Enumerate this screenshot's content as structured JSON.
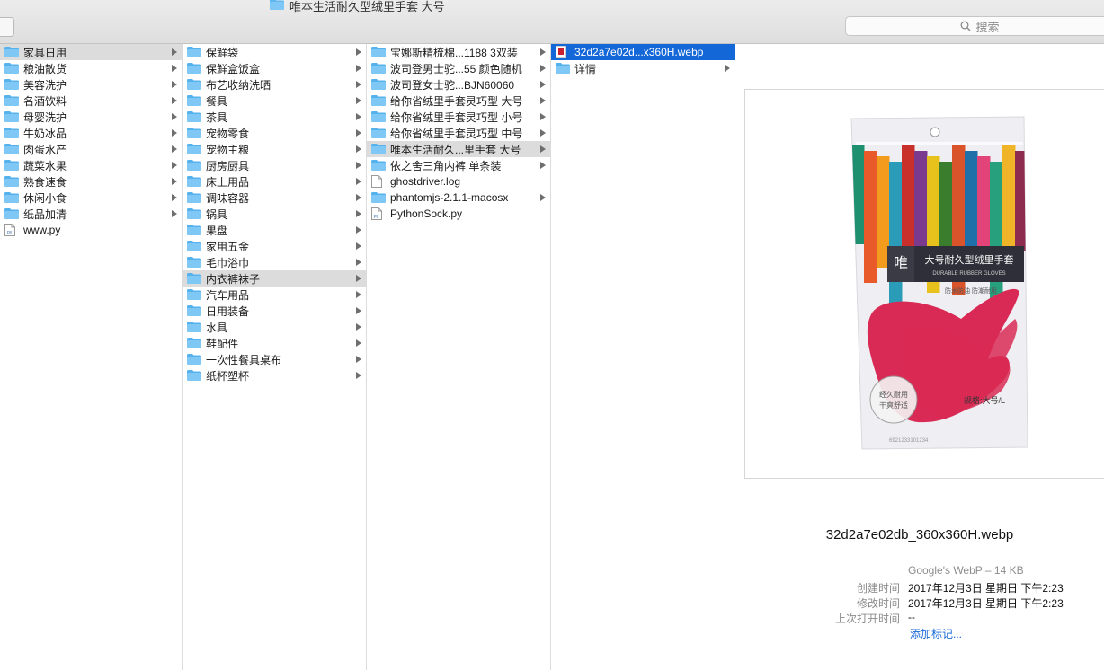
{
  "window": {
    "title": "唯本生活耐久型绒里手套 大号"
  },
  "search": {
    "placeholder": "搜索"
  },
  "columns": [
    {
      "items": [
        {
          "label": "家具日用",
          "type": "folder",
          "arrow": true,
          "state": "sel"
        },
        {
          "label": "粮油散货",
          "type": "folder",
          "arrow": true
        },
        {
          "label": "美容洗护",
          "type": "folder",
          "arrow": true
        },
        {
          "label": "名酒饮料",
          "type": "folder",
          "arrow": true
        },
        {
          "label": "母婴洗护",
          "type": "folder",
          "arrow": true
        },
        {
          "label": "牛奶冰品",
          "type": "folder",
          "arrow": true
        },
        {
          "label": "肉蛋水产",
          "type": "folder",
          "arrow": true
        },
        {
          "label": "蔬菜水果",
          "type": "folder",
          "arrow": true
        },
        {
          "label": "熟食速食",
          "type": "folder",
          "arrow": true
        },
        {
          "label": "休闲小食",
          "type": "folder",
          "arrow": true
        },
        {
          "label": "纸品加清",
          "type": "folder",
          "arrow": true
        },
        {
          "label": "www.py",
          "type": "file-py",
          "arrow": false
        }
      ]
    },
    {
      "items": [
        {
          "label": "保鲜袋",
          "type": "folder",
          "arrow": true
        },
        {
          "label": "保鲜盒饭盒",
          "type": "folder",
          "arrow": true
        },
        {
          "label": "布艺收纳洗晒",
          "type": "folder",
          "arrow": true
        },
        {
          "label": "餐具",
          "type": "folder",
          "arrow": true
        },
        {
          "label": "茶具",
          "type": "folder",
          "arrow": true
        },
        {
          "label": "宠物零食",
          "type": "folder",
          "arrow": true
        },
        {
          "label": "宠物主粮",
          "type": "folder",
          "arrow": true
        },
        {
          "label": "厨房厨具",
          "type": "folder",
          "arrow": true
        },
        {
          "label": "床上用品",
          "type": "folder",
          "arrow": true
        },
        {
          "label": "调味容器",
          "type": "folder",
          "arrow": true
        },
        {
          "label": "锅具",
          "type": "folder",
          "arrow": true
        },
        {
          "label": "果盘",
          "type": "folder",
          "arrow": true
        },
        {
          "label": "家用五金",
          "type": "folder",
          "arrow": true
        },
        {
          "label": "毛巾浴巾",
          "type": "folder",
          "arrow": true
        },
        {
          "label": "内衣裤袜子",
          "type": "folder",
          "arrow": true,
          "state": "sel"
        },
        {
          "label": "汽车用品",
          "type": "folder",
          "arrow": true
        },
        {
          "label": "日用装备",
          "type": "folder",
          "arrow": true
        },
        {
          "label": "水具",
          "type": "folder",
          "arrow": true
        },
        {
          "label": "鞋配件",
          "type": "folder",
          "arrow": true
        },
        {
          "label": "一次性餐具桌布",
          "type": "folder",
          "arrow": true
        },
        {
          "label": "纸杯塑杯",
          "type": "folder",
          "arrow": true
        }
      ]
    },
    {
      "items": [
        {
          "label": "宝娜斯精梳棉...1188 3双装",
          "type": "folder",
          "arrow": true
        },
        {
          "label": "波司登男士驼...55 颜色随机",
          "type": "folder",
          "arrow": true
        },
        {
          "label": "波司登女士驼...BJN60060",
          "type": "folder",
          "arrow": true
        },
        {
          "label": "给你省绒里手套灵巧型 大号",
          "type": "folder",
          "arrow": true
        },
        {
          "label": "给你省绒里手套灵巧型 小号",
          "type": "folder",
          "arrow": true
        },
        {
          "label": "给你省绒里手套灵巧型 中号",
          "type": "folder",
          "arrow": true
        },
        {
          "label": "唯本生活耐久...里手套 大号",
          "type": "folder",
          "arrow": true,
          "state": "sel"
        },
        {
          "label": "依之舍三角内裤 单条装",
          "type": "folder",
          "arrow": true
        },
        {
          "label": "ghostdriver.log",
          "type": "file",
          "arrow": false
        },
        {
          "label": "phantomjs-2.1.1-macosx",
          "type": "folder",
          "arrow": true
        },
        {
          "label": "PythonSock.py",
          "type": "file-py",
          "arrow": false
        }
      ]
    },
    {
      "items": [
        {
          "label": "32d2a7e02d...x360H.webp",
          "type": "image",
          "arrow": false,
          "state": "sel-active"
        },
        {
          "label": "详情",
          "type": "folder",
          "arrow": true
        }
      ]
    }
  ],
  "preview": {
    "filename": "32d2a7e02db_360x360H.webp",
    "kind": "Google's WebP – 14 KB",
    "meta": [
      {
        "key": "创建时间",
        "value": "2017年12月3日 星期日 下午2:23"
      },
      {
        "key": "修改时间",
        "value": "2017年12月3日 星期日 下午2:23"
      },
      {
        "key": "上次打开时间",
        "value": "--"
      }
    ],
    "add_tags_label": "添加标记...",
    "product": {
      "brand_mark": "唯",
      "title": "大号耐久型绒里手套",
      "subtitle": "DURABLE RUBBER GLOVES",
      "feature": "防水防油 防潮耐用",
      "badge_line1": "经久耐用",
      "badge_line2": "干爽舒适",
      "spec": "规格:大号/L",
      "barcode_text": "6921233101234",
      "stripe_colors": [
        "#1e8f6f",
        "#e85a2a",
        "#f29b1c",
        "#2a9cb8",
        "#c9302c",
        "#7a3b8f",
        "#e8c21c",
        "#3a7d2c",
        "#d9542b",
        "#1f6fa8",
        "#e2447a",
        "#27a17d",
        "#f0b429",
        "#8e2c50"
      ],
      "glove_color": "#d92a55"
    }
  }
}
